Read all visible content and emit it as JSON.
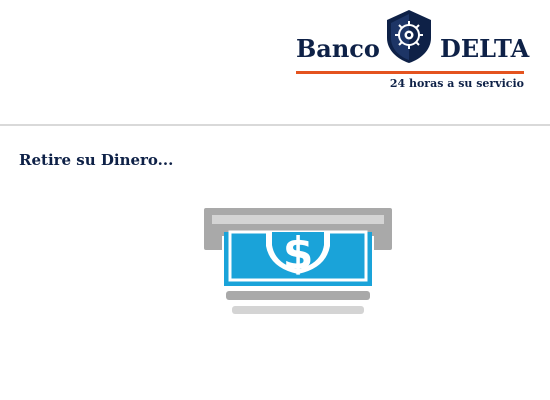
{
  "brand": {
    "name_left": "Banco",
    "name_right": "DELTA",
    "tagline": "24 horas a su servicio",
    "logo_icon": "vault-shield-icon"
  },
  "main": {
    "prompt": "Retire su Dinero...",
    "illustration_icon": "cash-withdrawal-icon",
    "currency_symbol": "$"
  },
  "colors": {
    "brand_navy": "#0e2147",
    "accent_orange": "#e4531f",
    "cash_blue": "#1aa3d9",
    "slot_gray": "#a9a9a9"
  }
}
